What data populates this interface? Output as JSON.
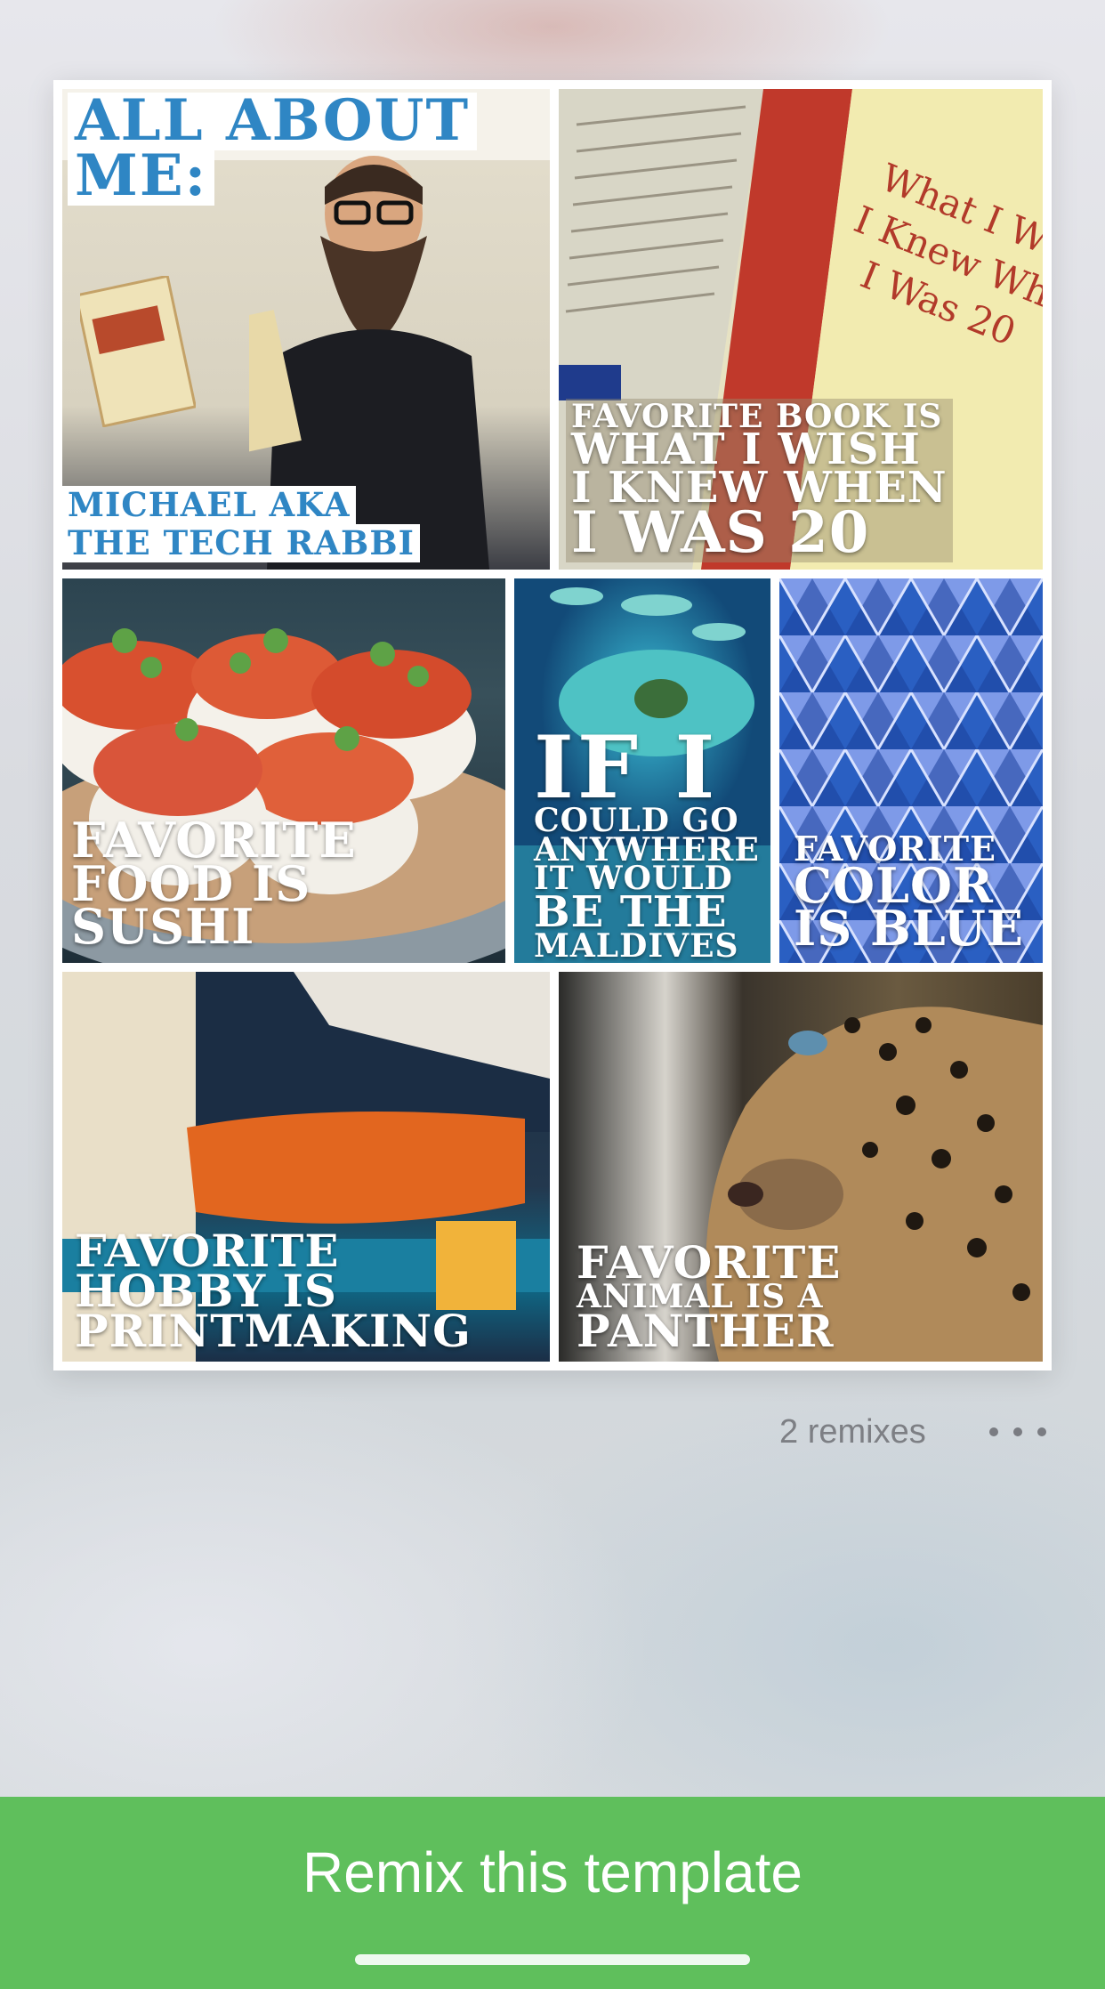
{
  "collage": {
    "tile1": {
      "title_line1": "ALL ABOUT",
      "title_line2": "ME:",
      "name_line1": "MICHAEL AKA",
      "name_line2": "THE TECH RABBI"
    },
    "tile2": {
      "caption": [
        "FAVORITE BOOK IS",
        "WHAT I WISH",
        "I KNEW WHEN",
        "I WAS 20"
      ]
    },
    "tile3": {
      "caption": [
        "FAVORITE",
        "FOOD IS",
        "SUSHI"
      ]
    },
    "tile4": {
      "caption_big": "IF I",
      "caption_lines": [
        "COULD GO",
        "ANYWHERE",
        "IT WOULD"
      ],
      "caption_mid": "BE THE",
      "caption_end": "MALDIVES"
    },
    "tile5": {
      "caption_small": "FAVORITE",
      "caption": [
        "COLOR",
        "IS BLUE"
      ]
    },
    "tile6": {
      "caption": [
        "FAVORITE",
        "HOBBY IS",
        "PRINTMAKING"
      ]
    },
    "tile7": {
      "caption_line1": "FAVORITE",
      "caption_small": "ANIMAL IS A",
      "caption_line3": "PANTHER"
    }
  },
  "meta": {
    "remixes": "2 remixes",
    "more_icon": "more-horizontal-icon"
  },
  "cta": {
    "label": "Remix this template",
    "color": "#5fbf5c"
  }
}
